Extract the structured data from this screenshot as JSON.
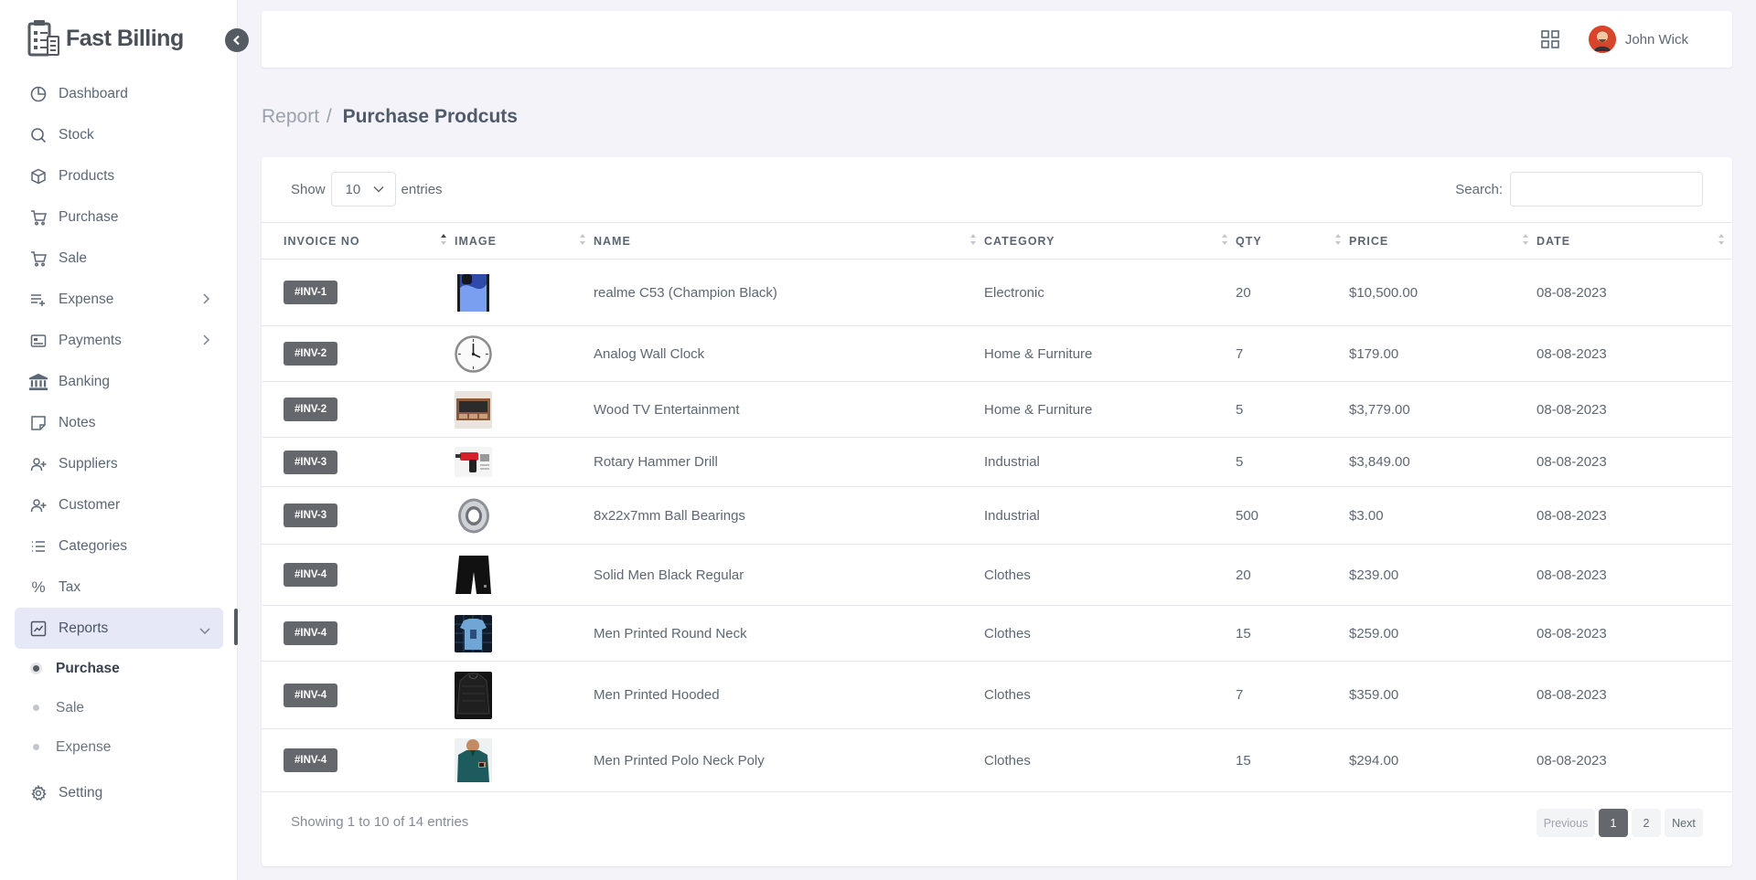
{
  "app": {
    "name": "Fast Billing"
  },
  "user": {
    "name": "John Wick"
  },
  "sidebar": {
    "items": [
      {
        "label": "Dashboard",
        "icon": "dashboard-icon"
      },
      {
        "label": "Stock",
        "icon": "search-icon"
      },
      {
        "label": "Products",
        "icon": "box-icon"
      },
      {
        "label": "Purchase",
        "icon": "cart-icon"
      },
      {
        "label": "Sale",
        "icon": "cart-icon"
      },
      {
        "label": "Expense",
        "icon": "list-plus-icon",
        "expandable": true
      },
      {
        "label": "Payments",
        "icon": "card-icon",
        "expandable": true
      },
      {
        "label": "Banking",
        "icon": "bank-icon"
      },
      {
        "label": "Notes",
        "icon": "note-icon"
      },
      {
        "label": "Suppliers",
        "icon": "user-plus-icon"
      },
      {
        "label": "Customer",
        "icon": "user-plus-icon"
      },
      {
        "label": "Categories",
        "icon": "list-icon"
      },
      {
        "label": "Tax",
        "icon": "percent-icon"
      },
      {
        "label": "Reports",
        "icon": "chart-icon",
        "active": true,
        "expanded": true
      }
    ],
    "report_sub_items": [
      {
        "label": "Purchase",
        "active": true
      },
      {
        "label": "Sale",
        "active": false
      },
      {
        "label": "Expense",
        "active": false
      }
    ],
    "setting_label": "Setting"
  },
  "breadcrumb": {
    "parent": "Report",
    "separator": "/",
    "current": "Purchase Prodcuts"
  },
  "table_controls": {
    "show_label": "Show",
    "entries_value": "10",
    "entries_label": "entries",
    "search_label": "Search:",
    "search_value": ""
  },
  "table": {
    "columns": [
      "INVOICE NO",
      "IMAGE",
      "NAME",
      "CATEGORY",
      "QTY",
      "PRICE",
      "DATE"
    ],
    "rows": [
      {
        "invoice": "#INV-1",
        "name": "realme C53 (Champion Black)",
        "category": "Electronic",
        "qty": "20",
        "price": "$10,500.00",
        "date": "08-08-2023"
      },
      {
        "invoice": "#INV-2",
        "name": "Analog Wall Clock",
        "category": "Home & Furniture",
        "qty": "7",
        "price": "$179.00",
        "date": "08-08-2023"
      },
      {
        "invoice": "#INV-2",
        "name": "Wood TV Entertainment",
        "category": "Home & Furniture",
        "qty": "5",
        "price": "$3,779.00",
        "date": "08-08-2023"
      },
      {
        "invoice": "#INV-3",
        "name": "Rotary Hammer Drill",
        "category": "Industrial",
        "qty": "5",
        "price": "$3,849.00",
        "date": "08-08-2023"
      },
      {
        "invoice": "#INV-3",
        "name": "8x22x7mm Ball Bearings",
        "category": "Industrial",
        "qty": "500",
        "price": "$3.00",
        "date": "08-08-2023"
      },
      {
        "invoice": "#INV-4",
        "name": "Solid Men Black Regular",
        "category": "Clothes",
        "qty": "20",
        "price": "$239.00",
        "date": "08-08-2023"
      },
      {
        "invoice": "#INV-4",
        "name": "Men Printed Round Neck",
        "category": "Clothes",
        "qty": "15",
        "price": "$259.00",
        "date": "08-08-2023"
      },
      {
        "invoice": "#INV-4",
        "name": "Men Printed Hooded",
        "category": "Clothes",
        "qty": "7",
        "price": "$359.00",
        "date": "08-08-2023"
      },
      {
        "invoice": "#INV-4",
        "name": "Men Printed Polo Neck Poly",
        "category": "Clothes",
        "qty": "15",
        "price": "$294.00",
        "date": "08-08-2023"
      }
    ]
  },
  "footer": {
    "info": "Showing 1 to 10 of 14 entries"
  },
  "pagination": {
    "previous": "Previous",
    "pages": [
      "1",
      "2"
    ],
    "current": "1",
    "next": "Next"
  },
  "colors": {
    "accent": "#64686c",
    "active_bg": "#e6e8f7",
    "page_bg": "#f3f3f9",
    "avatar": "#d9452b"
  }
}
